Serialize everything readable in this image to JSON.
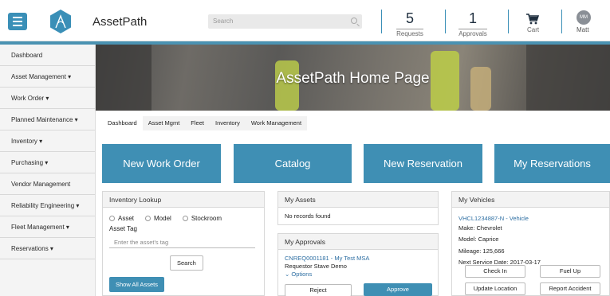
{
  "header": {
    "app_title": "AssetPath",
    "search_placeholder": "Search",
    "requests_count": "5",
    "requests_label": "Requests",
    "approvals_count": "1",
    "approvals_label": "Approvals",
    "cart_label": "Cart",
    "user_initials": "MM",
    "user_name": "Matt"
  },
  "sidebar": {
    "items": [
      {
        "label": "Dashboard"
      },
      {
        "label": "Asset Management ▾"
      },
      {
        "label": "Work Order ▾"
      },
      {
        "label": "Planned Maintenance ▾"
      },
      {
        "label": "Inventory ▾"
      },
      {
        "label": "Purchasing ▾"
      },
      {
        "label": "Vendor Management"
      },
      {
        "label": "Reliability Engineering ▾"
      },
      {
        "label": "Fleet Management ▾"
      },
      {
        "label": "Reservations ▾"
      }
    ]
  },
  "hero": {
    "title": "AssetPath Home Page"
  },
  "tabs": [
    {
      "label": "Dashboard"
    },
    {
      "label": "Asset Mgmt"
    },
    {
      "label": "Fleet"
    },
    {
      "label": "Inventory"
    },
    {
      "label": "Work Management"
    }
  ],
  "quick_actions": [
    {
      "label": "New Work Order"
    },
    {
      "label": "Catalog"
    },
    {
      "label": "New Reservation"
    },
    {
      "label": "My Reservations"
    }
  ],
  "inventory_lookup": {
    "title": "Inventory Lookup",
    "radio_asset": "Asset",
    "radio_model": "Model",
    "radio_stockroom": "Stockroom",
    "asset_tag_label": "Asset Tag",
    "asset_tag_placeholder": "Enter the asset's tag",
    "search_button": "Search",
    "show_all_button": "Show All Assets"
  },
  "my_assets": {
    "title": "My Assets",
    "empty_text": "No records found"
  },
  "my_approvals": {
    "title": "My Approvals",
    "request_link": "CNREQ0001181 - My Test MSA",
    "requestor": "Requestor Stave Demo",
    "options_label": "Options",
    "reject_button": "Reject",
    "approve_button": "Approve"
  },
  "my_vehicles": {
    "title": "My Vehicles",
    "vehicle_link": "VHCL1234887-N - Vehicle",
    "make": "Make: Chevrolet",
    "model": "Model: Caprice",
    "mileage": "Mileage: 125,666",
    "next_service": "Next Service Date: 2017-03-17",
    "check_in": "Check In",
    "fuel_up": "Fuel Up",
    "update_location": "Update Location",
    "report_accident": "Report Accident"
  },
  "colors": {
    "accent": "#3f8fb4",
    "link": "#2e6fa3",
    "sidebar_bg": "#f4f4f4"
  }
}
